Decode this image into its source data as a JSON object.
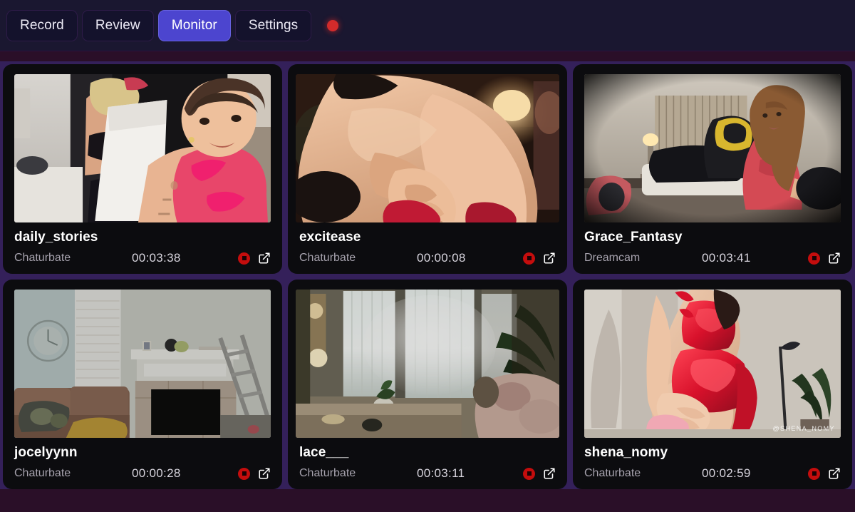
{
  "app": {
    "accent_active": "#4c45cf",
    "record_color": "#d22b2b",
    "page_bg": "#2a0f28",
    "grid_bg": "#34205a",
    "card_bg": "#0c0c0f"
  },
  "header": {
    "tabs": [
      {
        "label": "Record",
        "active": false,
        "name": "tab-record"
      },
      {
        "label": "Review",
        "active": false,
        "name": "tab-review"
      },
      {
        "label": "Monitor",
        "active": true,
        "name": "tab-monitor"
      },
      {
        "label": "Settings",
        "active": false,
        "name": "tab-settings"
      }
    ],
    "status_indicator": "recording-dot"
  },
  "icons": {
    "stop": "stop-record-icon",
    "open_external": "external-link-icon",
    "status": "recording-indicator-dot"
  },
  "cards": [
    {
      "title": "daily_stories",
      "site": "Chaturbate",
      "duration": "00:03:38",
      "watermark": "",
      "scene": "bedroom-pink-top"
    },
    {
      "title": "excitease",
      "site": "Chaturbate",
      "duration": "00:00:08",
      "watermark": "",
      "scene": "warm-closeup"
    },
    {
      "title": "Grace_Fantasy",
      "site": "Dreamcam",
      "duration": "00:03:41",
      "watermark": "",
      "scene": "bedroom-gaming-chair"
    },
    {
      "title": "jocelyynn",
      "site": "Chaturbate",
      "duration": "00:00:28",
      "watermark": "",
      "scene": "livingroom-fireplace"
    },
    {
      "title": "lace___",
      "site": "Chaturbate",
      "duration": "00:03:11",
      "watermark": "",
      "scene": "bright-window-room"
    },
    {
      "title": "shena_nomy",
      "site": "Chaturbate",
      "duration": "00:02:59",
      "watermark": "@SHENA_NOMY",
      "scene": "red-outfit-studio"
    }
  ]
}
